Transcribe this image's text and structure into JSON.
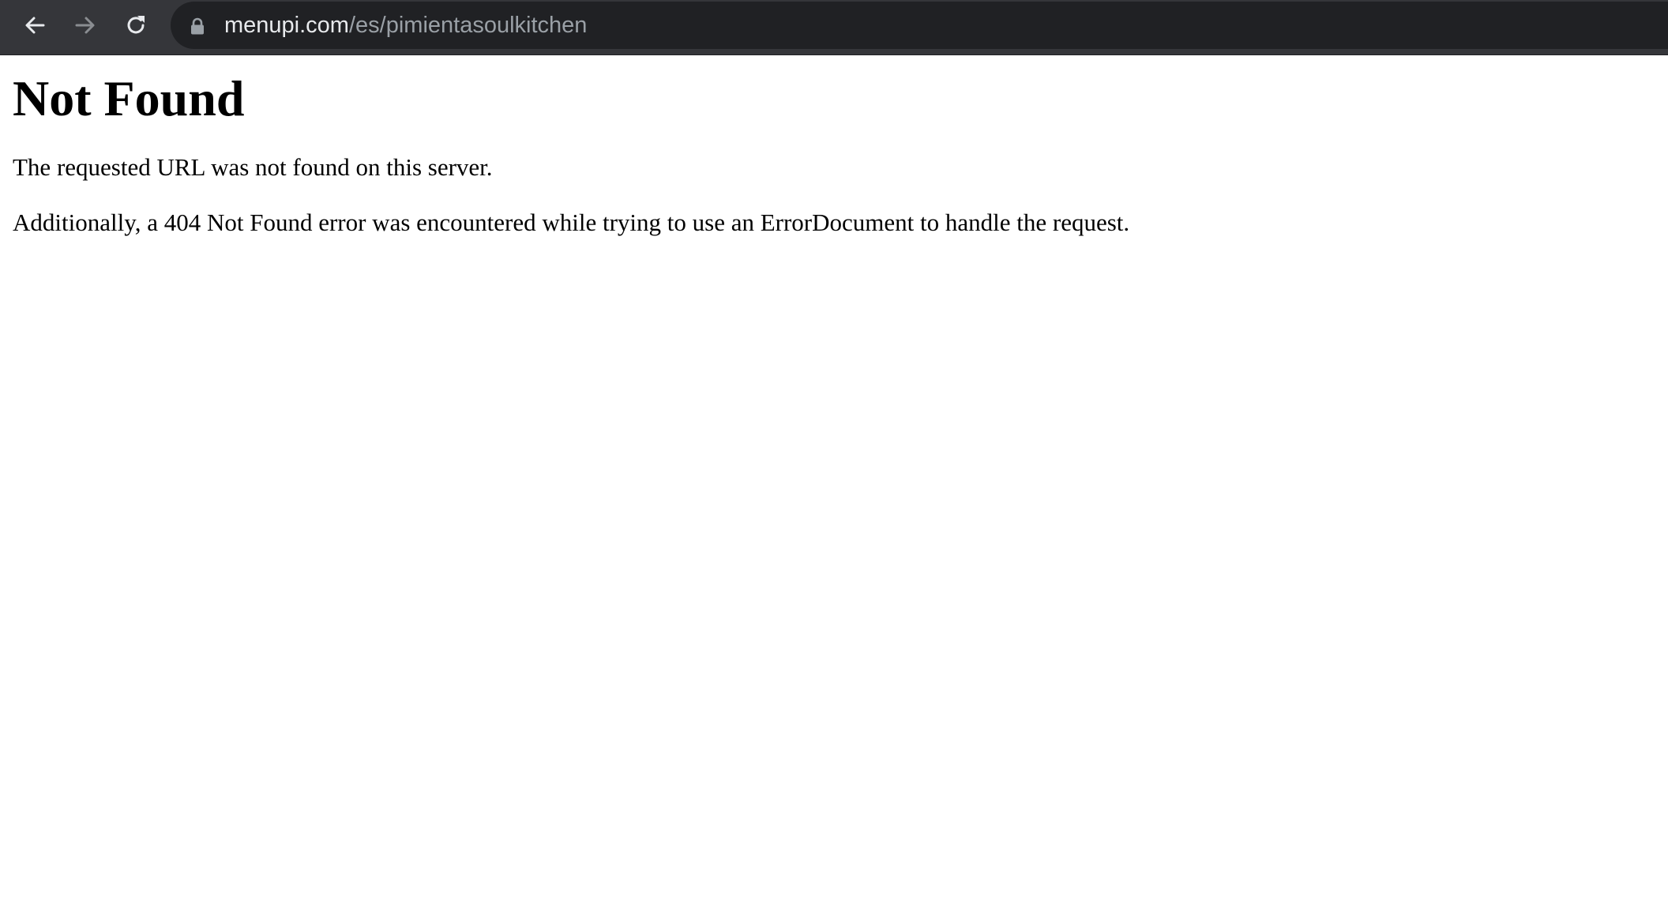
{
  "browser": {
    "url_host": "menupi.com",
    "url_path": "/es/pimientasoulkitchen",
    "icons": {
      "back": "arrow-left-icon",
      "forward": "arrow-right-icon",
      "reload": "reload-icon",
      "secure": "lock-icon"
    },
    "colors": {
      "toolbar_bg": "#35363a",
      "omnibox_bg": "#202124",
      "url_host": "#e8eaed",
      "url_path": "#9aa0a6"
    }
  },
  "page": {
    "heading": "Not Found",
    "message": "The requested URL was not found on this server.",
    "detail": "Additionally, a 404 Not Found error was encountered while trying to use an ErrorDocument to handle the request."
  }
}
